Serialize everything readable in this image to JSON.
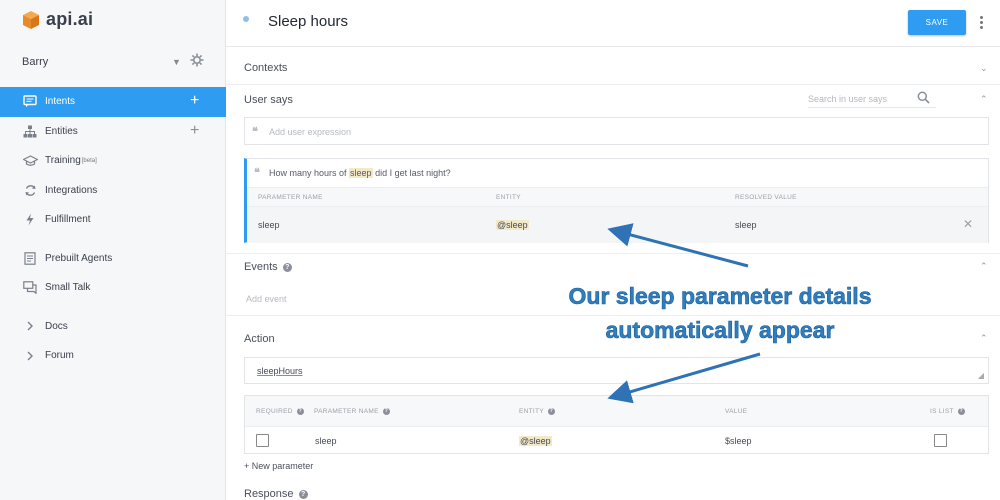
{
  "app": {
    "logo_text": "api.ai",
    "accent": "#2e9df1"
  },
  "sidebar": {
    "agent_name": "Barry",
    "items": [
      {
        "label": "Intents",
        "icon": "chat-icon",
        "active": true,
        "has_add": true
      },
      {
        "label": "Entities",
        "icon": "hierarchy-icon",
        "has_add": true
      },
      {
        "label": "Training",
        "badge": "[beta]",
        "icon": "graduation-cap-icon"
      },
      {
        "label": "Integrations",
        "icon": "sync-icon"
      },
      {
        "label": "Fulfillment",
        "icon": "lightning-icon"
      },
      {
        "label": "Prebuilt Agents",
        "icon": "document-icon"
      },
      {
        "label": "Small Talk",
        "icon": "chat-bubbles-icon"
      },
      {
        "label": "Docs",
        "icon": "chevron-right-icon"
      },
      {
        "label": "Forum",
        "icon": "chevron-right-icon"
      }
    ]
  },
  "header": {
    "title": "Sleep hours",
    "save_label": "SAVE"
  },
  "sections": {
    "contexts": "Contexts",
    "user_says": "User says",
    "events": "Events",
    "action": "Action",
    "response": "Response"
  },
  "user_says": {
    "search_placeholder": "Search in user says",
    "add_placeholder": "Add user expression",
    "utterance": {
      "before": "How many hours of ",
      "highlight": "sleep",
      "after": " did I get last night?"
    },
    "columns": [
      "PARAMETER NAME",
      "ENTITY",
      "RESOLVED VALUE"
    ],
    "row": {
      "name": "sleep",
      "entity": "@sleep",
      "value": "sleep"
    }
  },
  "events": {
    "add_placeholder": "Add event"
  },
  "action": {
    "value": "sleepHours",
    "columns": [
      "REQUIRED",
      "PARAMETER NAME",
      "ENTITY",
      "VALUE",
      "IS LIST"
    ],
    "row": {
      "name": "sleep",
      "entity": "@sleep",
      "value": "$sleep",
      "required": false,
      "is_list": false
    },
    "new_parameter": "+ New parameter"
  },
  "annotation": {
    "line1": "Our sleep parameter details",
    "line2": "automatically appear",
    "color": "#2f7fc0"
  }
}
